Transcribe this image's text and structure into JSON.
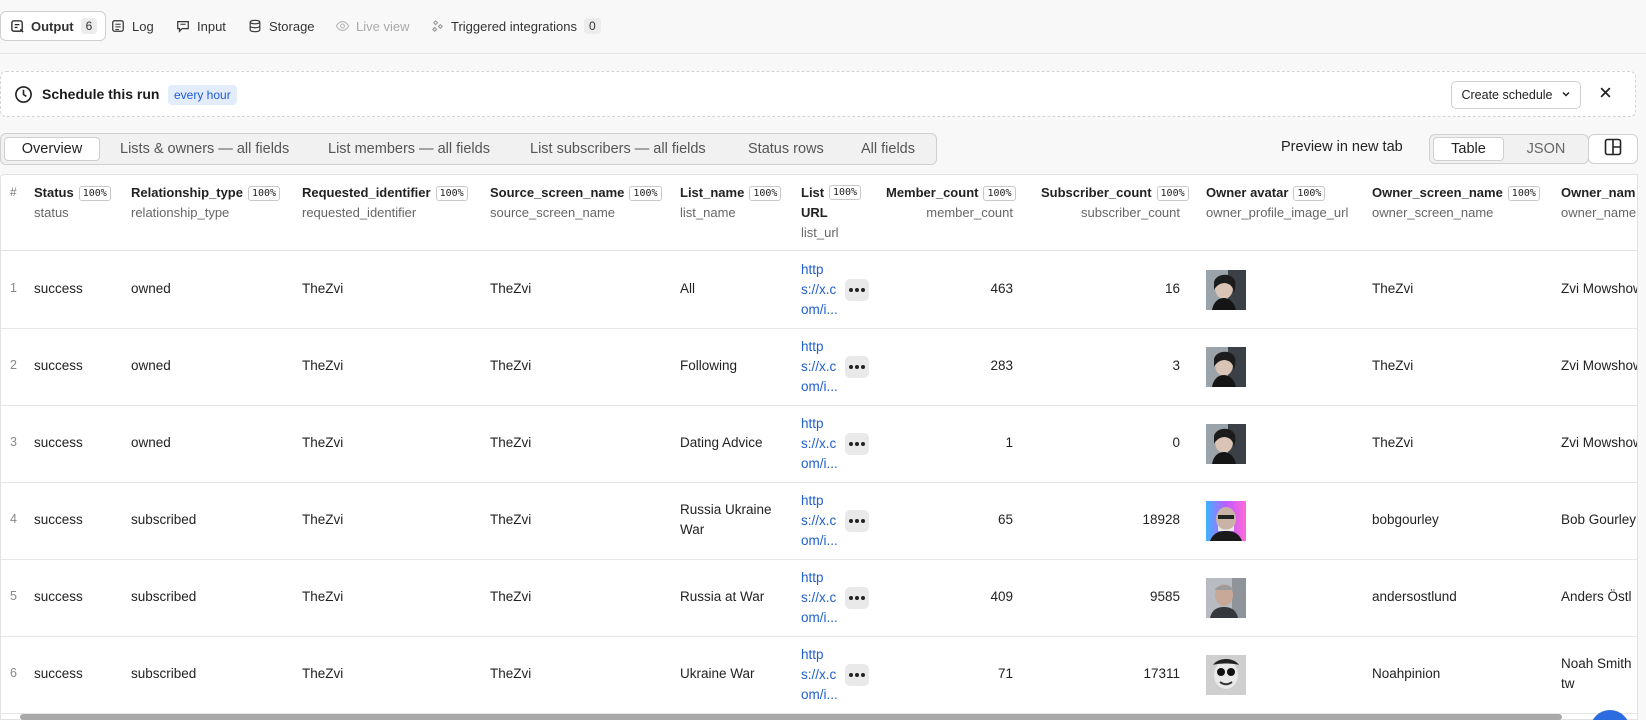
{
  "top_tabs": {
    "output": {
      "label": "Output",
      "count": "6"
    },
    "log": {
      "label": "Log"
    },
    "input": {
      "label": "Input"
    },
    "storage": {
      "label": "Storage"
    },
    "live_view": {
      "label": "Live view"
    },
    "triggered": {
      "label": "Triggered integrations",
      "count": "0"
    }
  },
  "schedule": {
    "title": "Schedule this run",
    "badge": "every hour",
    "create_label": "Create schedule"
  },
  "view_tabs": [
    "Overview",
    "Lists & owners — all fields",
    "List members — all fields",
    "List subscribers — all fields",
    "Status rows",
    "All fields"
  ],
  "preview_label": "Preview in new tab",
  "format_toggle": {
    "table": "Table",
    "json": "JSON"
  },
  "table": {
    "index_header": "#",
    "columns": [
      {
        "name": "Status",
        "pct": "100%",
        "field": "status"
      },
      {
        "name": "Relationship_type",
        "pct": "100%",
        "field": "relationship_type"
      },
      {
        "name": "Requested_identifier",
        "pct": "100%",
        "field": "requested_identifier"
      },
      {
        "name": "Source_screen_name",
        "pct": "100%",
        "field": "source_screen_name"
      },
      {
        "name": "List_name",
        "pct": "100%",
        "field": "list_name"
      },
      {
        "name": "List URL",
        "name_line1": "List",
        "name_line2": "URL",
        "pct": "100%",
        "field": "list_url"
      },
      {
        "name": "Member_count",
        "pct": "100%",
        "field": "member_count"
      },
      {
        "name": "Subscriber_count",
        "pct": "100%",
        "field": "subscriber_count"
      },
      {
        "name": "Owner avatar",
        "pct": "100%",
        "field": "owner_profile_image_url"
      },
      {
        "name": "Owner_screen_name",
        "pct": "100%",
        "field": "owner_screen_name"
      },
      {
        "name": "Owner_nam",
        "field": "owner_name"
      }
    ],
    "rows": [
      {
        "idx": "1",
        "status": "success",
        "relationship_type": "owned",
        "requested_identifier": "TheZvi",
        "source_screen_name": "TheZvi",
        "list_name_1": "All",
        "list_name_2": "",
        "url_1": "http",
        "url_2": "s://x.c",
        "url_3": "om/i...",
        "member_count": "463",
        "subscriber_count": "16",
        "owner_screen_name": "TheZvi",
        "owner_name_1": "Zvi Mowshow",
        "owner_name_2": ""
      },
      {
        "idx": "2",
        "status": "success",
        "relationship_type": "owned",
        "requested_identifier": "TheZvi",
        "source_screen_name": "TheZvi",
        "list_name_1": "Following",
        "list_name_2": "",
        "url_1": "http",
        "url_2": "s://x.c",
        "url_3": "om/i...",
        "member_count": "283",
        "subscriber_count": "3",
        "owner_screen_name": "TheZvi",
        "owner_name_1": "Zvi Mowshow",
        "owner_name_2": ""
      },
      {
        "idx": "3",
        "status": "success",
        "relationship_type": "owned",
        "requested_identifier": "TheZvi",
        "source_screen_name": "TheZvi",
        "list_name_1": "Dating Advice",
        "list_name_2": "",
        "url_1": "http",
        "url_2": "s://x.c",
        "url_3": "om/i...",
        "member_count": "1",
        "subscriber_count": "0",
        "owner_screen_name": "TheZvi",
        "owner_name_1": "Zvi Mowshow",
        "owner_name_2": ""
      },
      {
        "idx": "4",
        "status": "success",
        "relationship_type": "subscribed",
        "requested_identifier": "TheZvi",
        "source_screen_name": "TheZvi",
        "list_name_1": "Russia Ukraine",
        "list_name_2": "War",
        "url_1": "http",
        "url_2": "s://x.c",
        "url_3": "om/i...",
        "member_count": "65",
        "subscriber_count": "18928",
        "owner_screen_name": "bobgourley",
        "owner_name_1": "Bob Gourley",
        "owner_name_2": ""
      },
      {
        "idx": "5",
        "status": "success",
        "relationship_type": "subscribed",
        "requested_identifier": "TheZvi",
        "source_screen_name": "TheZvi",
        "list_name_1": "Russia at War",
        "list_name_2": "",
        "url_1": "http",
        "url_2": "s://x.c",
        "url_3": "om/i...",
        "member_count": "409",
        "subscriber_count": "9585",
        "owner_screen_name": "andersostlund",
        "owner_name_1": "Anders Östl",
        "owner_name_2": ""
      },
      {
        "idx": "6",
        "status": "success",
        "relationship_type": "subscribed",
        "requested_identifier": "TheZvi",
        "source_screen_name": "TheZvi",
        "list_name_1": "Ukraine War",
        "list_name_2": "",
        "url_1": "http",
        "url_2": "s://x.c",
        "url_3": "om/i...",
        "member_count": "71",
        "subscriber_count": "17311",
        "owner_screen_name": "Noahpinion",
        "owner_name_1": "Noah Smith",
        "owner_name_2": "tw"
      }
    ]
  },
  "colors": {
    "accent": "#1f5fd0",
    "badge_bg": "#e3ecfb"
  }
}
